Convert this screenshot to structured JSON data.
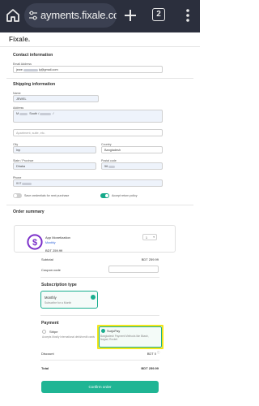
{
  "browser": {
    "url": "ayments.fixale.com",
    "tab_count": "2"
  },
  "logo": "Fixale.",
  "contact": {
    "title": "Contact information",
    "email_label": "Email Address",
    "email_value_start": "jewe",
    "email_value_end": "ly@gmail.com"
  },
  "shipping": {
    "title": "Shipping information",
    "name_label": "Name",
    "name_value": "JEWEL",
    "address_label": "Address",
    "address_value_start": "M",
    "address_value_mid": "South /",
    "address_value_end": "/",
    "apartment_placeholder": "Apartment, suite, etc.",
    "city_label": "City",
    "city_value": "Inp",
    "country_label": "Country",
    "country_value": "Bangladesh",
    "state_label": "State / Province",
    "state_value": "Dhaka",
    "postal_label": "Postal code",
    "postal_value": "56",
    "phone_label": "Phone",
    "phone_value": "017",
    "save_details_label": "Save credentials for next purchase",
    "accept_policy_label": "Accept return policy"
  },
  "order": {
    "title": "Order summary",
    "product_name": "App Monetization",
    "product_plan": "Monthly",
    "product_price": "BDT   259.99",
    "quantity": "1",
    "subtotal_label": "Subtotal",
    "subtotal_value": "BDT  259.99",
    "coupon_label": "Coupon code"
  },
  "subscription": {
    "title": "Subscription type",
    "option_title": "Monthly",
    "option_desc": "Subscribe for a Month"
  },
  "payment": {
    "title": "Payment",
    "stripe_title": "Stripe",
    "stripe_desc": "Accepts Mostly International debit/credit cards",
    "surjo_title": "SurjoPay",
    "surjo_desc": "Bangladesh Payment Methods like Bkash, Nagad, Rocket",
    "discount_label": "Discount",
    "discount_value": "BDT 0",
    "total_label": "Total",
    "total_value": "BDT  259.99"
  },
  "confirm_label": "Confirm order",
  "colors": {
    "accent": "#1fb594",
    "highlight": "#f3e61b",
    "product_icon": "#7b2fc9"
  }
}
